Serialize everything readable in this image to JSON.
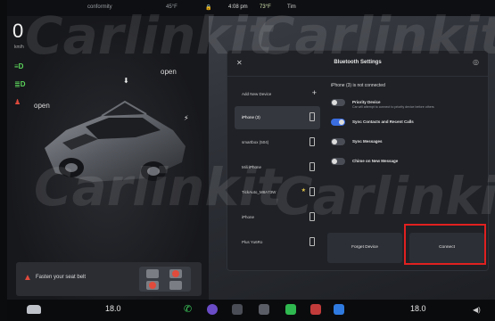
{
  "status_bar": {
    "drive_mode": "conformity",
    "temperature": "45°F",
    "lock": "🔒",
    "time": "4:08 pm",
    "weather": "73°F",
    "user": "Tim"
  },
  "left_panel": {
    "speed": "0",
    "speed_unit": "km/h",
    "open_left": "open",
    "open_right": "open",
    "seatbelt_alert": "Fasten your seat belt"
  },
  "dialog": {
    "title": "Bluetooth Settings",
    "add_new_device": "Add New Device",
    "devices": [
      {
        "name": "iPhone (3)",
        "selected": true,
        "favorite": false
      },
      {
        "name": "smartbox (504)",
        "selected": false,
        "favorite": false
      },
      {
        "name": "Mili iPhone",
        "selected": false,
        "favorite": false
      },
      {
        "name": "TickAuto_M8A73W",
        "selected": false,
        "favorite": true
      },
      {
        "name": "iPhone",
        "selected": false,
        "favorite": false
      },
      {
        "name": "Plus Yu6Ro",
        "selected": false,
        "favorite": false
      }
    ],
    "detail_title": "iPhone (3) is not connected",
    "options": [
      {
        "label": "Priority Device",
        "subtext": "Car will attempt to connect to priority device before others",
        "on": false
      },
      {
        "label": "Sync Contacts and Recent Calls",
        "subtext": "",
        "on": true
      },
      {
        "label": "Sync Messages",
        "subtext": "",
        "on": false
      },
      {
        "label": "Chime on New Message",
        "subtext": "",
        "on": false
      }
    ],
    "forget_button": "Forget Device",
    "connect_button": "Connect"
  },
  "dock": {
    "temp_left": "18.0",
    "temp_right": "18.0"
  },
  "watermark": "Carlinkit",
  "colors": {
    "accent_toggle": "#3a6de0",
    "highlight": "#e02020",
    "alert_red": "#e04b3c",
    "indicator_green": "#5cd65c"
  }
}
